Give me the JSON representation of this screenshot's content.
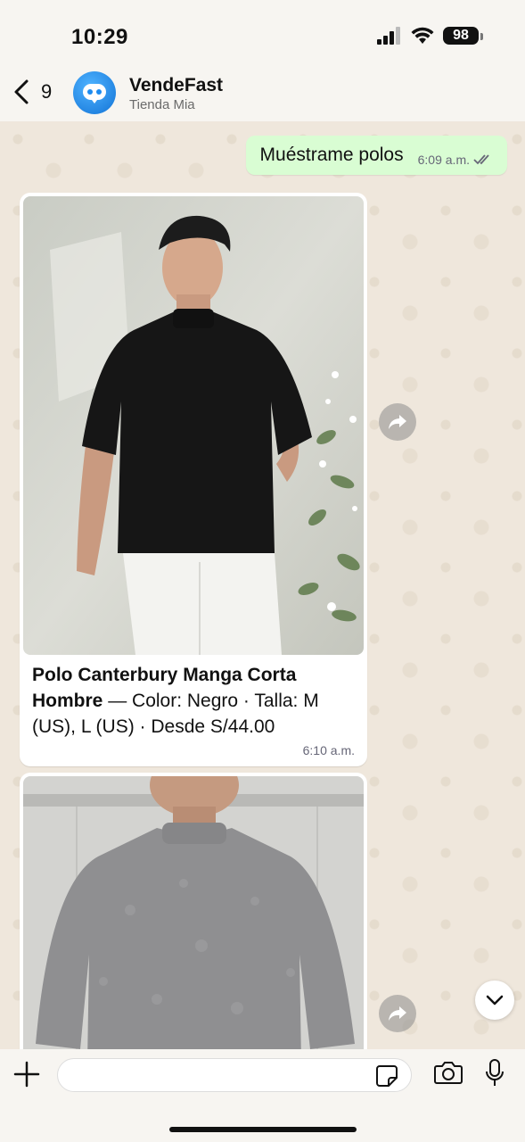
{
  "status_bar": {
    "time": "10:29",
    "battery": "98"
  },
  "header": {
    "back_count": "9",
    "contact_name": "VendeFast",
    "contact_subtitle": "Tienda Mia"
  },
  "messages": {
    "sent": {
      "text": "Muéstrame polos",
      "time": "6:09 a.m."
    },
    "product1": {
      "title": "Polo Canterbury Manga Corta Hombre",
      "details": " — Color: Negro · Talla: M (US), L (US) · Desde S/44.00",
      "time": "6:10 a.m."
    }
  },
  "input": {
    "placeholder": ""
  },
  "colors": {
    "sent_bubble": "#d9fdd3",
    "background": "#efe7dc",
    "avatar": "#1e8cf0"
  }
}
